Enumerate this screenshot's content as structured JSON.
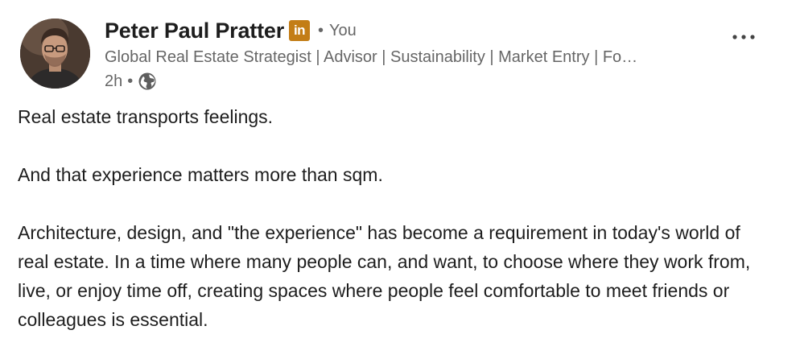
{
  "author": {
    "name": "Peter Paul Pratter",
    "badge": "in",
    "relation": "You",
    "headline": "Global Real Estate Strategist | Advisor | Sustainability | Market Entry | Fo…",
    "time": "2h",
    "separator": "•"
  },
  "post": {
    "paragraphs": [
      "Real estate transports feelings.",
      "And that experience matters more than sqm.",
      "Architecture, design, and \"the experience\" has become a requirement in today's world of real estate. In a time where many people can, and want, to choose where they work from, live, or enjoy time off, creating spaces where people feel comfortable to meet friends or colleagues is essential."
    ]
  },
  "icons": {
    "globe": "globe-icon",
    "more": "more-options-icon",
    "badge": "linkedin-premium-badge-icon"
  },
  "colors": {
    "badge": "#c37d16",
    "secondary_text": "#666666",
    "primary_text": "#1d1d1d"
  }
}
